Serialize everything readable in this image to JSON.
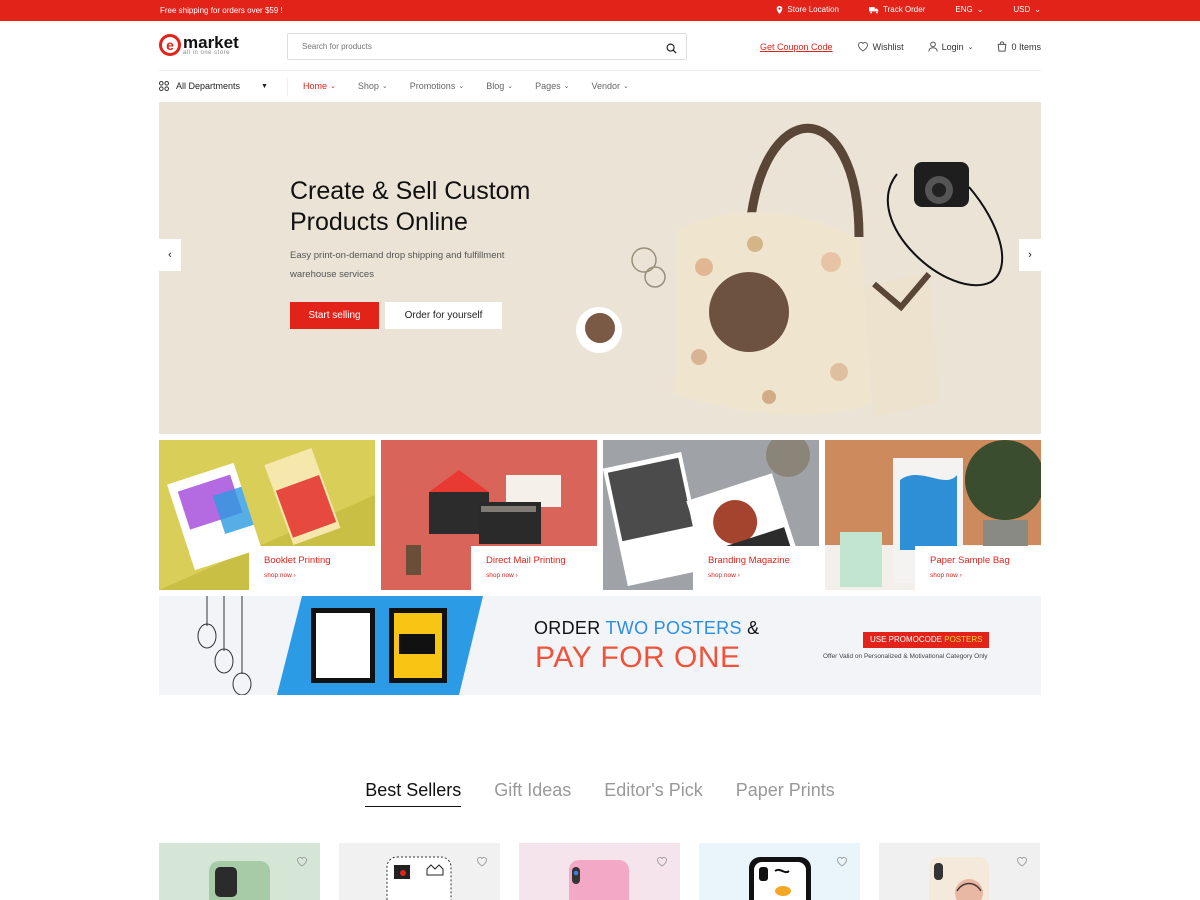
{
  "topbar": {
    "shipping": "Free shipping for orders over $59 !",
    "store_location": "Store Location",
    "track_order": "Track Order",
    "language": "ENG",
    "currency": "USD"
  },
  "header": {
    "logo_letter": "e",
    "logo_name": "market",
    "logo_tagline": "all in one store",
    "search_placeholder": "Search for products",
    "coupon": "Get Coupon Code",
    "wishlist": "Wishlist",
    "login": "Login",
    "cart": "0 Items"
  },
  "nav": {
    "departments": "All Departments",
    "items": [
      "Home",
      "Shop",
      "Promotions",
      "Blog",
      "Pages",
      "Vendor"
    ]
  },
  "hero": {
    "title": "Create & Sell Custom Products Online",
    "subtitle": "Easy print-on-demand drop shipping and fulfillment warehouse services",
    "primary_button": "Start selling",
    "secondary_button": "Order for yourself",
    "prev": "‹",
    "next": "›"
  },
  "categories": [
    {
      "title": "Booklet Printing",
      "link": "shop now  ›"
    },
    {
      "title": "Direct Mail Printing",
      "link": "shop now  ›"
    },
    {
      "title": "Branding Magazine",
      "link": "shop now  ›"
    },
    {
      "title": "Paper Sample Bag",
      "link": "shop now  ›"
    }
  ],
  "promo": {
    "line1_a": "ORDER ",
    "line1_b": "TWO POSTERS",
    "line1_c": " &",
    "line2": "PAY FOR ONE",
    "code_prefix": "USE PROMOCODE ",
    "code": "POSTERS",
    "valid": "Offer Valid on Personalized & Motivational Category Only"
  },
  "tabs": [
    "Best Sellers",
    "Gift Ideas",
    "Editor's Pick",
    "Paper Prints"
  ],
  "colors": {
    "accent": "#e2231a",
    "hero_bg": "#ebe3d6",
    "promo_blue": "#2a8fe4",
    "promo_orange": "#f0533a"
  }
}
